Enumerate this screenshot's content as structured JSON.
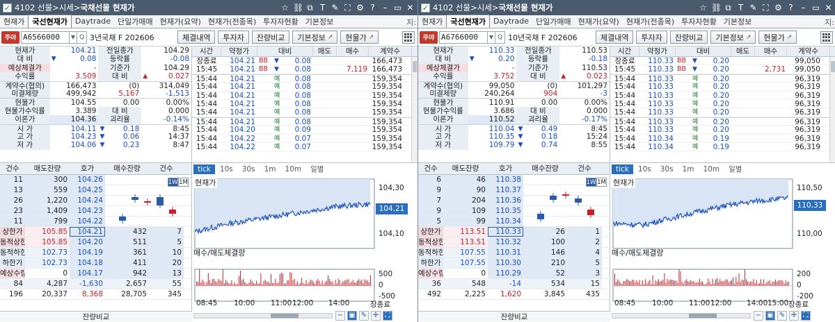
{
  "windows": [
    {
      "title_prefix": "4102 선물>시세>",
      "title_bold": "국채선물 현재가",
      "tabs": [
        "현재가",
        "국선현재가",
        "Daytrade",
        "단일가매매",
        "현재가(요약)",
        "현재가(전종목)",
        "투자자현황",
        "기본정보"
      ],
      "tab_more": "지:",
      "active_tab": 1,
      "code_badge": "주야",
      "code": "A6566000",
      "code_name": "3년국채 F 202606",
      "buttons": [
        "체결내역",
        "투자자",
        "잔량비교",
        "기본정보",
        "현물가"
      ],
      "quote": {
        "rows": [
          {
            "l1": "현재가",
            "v1": "104.21",
            "l2": "전일종가",
            "v2": "104.29"
          },
          {
            "l1": "대 비",
            "v1": "0.08",
            "l2": "등락률",
            "v2": "-0.08"
          },
          {
            "l1": "예상체결가",
            "v1": "-",
            "l2": "기준가",
            "v2": "104.29"
          },
          {
            "l1": "수익률",
            "v1": "3.509",
            "l2": "대 비",
            "v2": "0.027"
          },
          {
            "l1": "계약수(협의)",
            "v1": "166,473",
            "m": "(0)",
            "v2": "314,049"
          },
          {
            "l1": "미결제량",
            "v1": "499,942",
            "m": "5,167",
            "v2": "-1,513"
          },
          {
            "l1": "현물가",
            "v1": "104.55",
            "m": "0.00",
            "v2": "0.00%"
          },
          {
            "l1": "현물가수익률",
            "v1": "3.389",
            "l2": "대 비",
            "v2": "0.000"
          },
          {
            "l1": "이론가",
            "v1": "104.36",
            "l2": "괴리율",
            "v2": "-0.14%"
          },
          {
            "l1": "시 가",
            "v1": "104.11",
            "m": "0.18",
            "v2": "8:45"
          },
          {
            "l1": "고 가",
            "v1": "104.23",
            "m": "0.06",
            "v2": "14:37"
          },
          {
            "l1": "저 가",
            "v1": "104.06",
            "m": "0.23",
            "v2": "8:47"
          }
        ]
      },
      "trades": {
        "headers": [
          "시간",
          "약정가",
          "대비",
          "매도",
          "매수",
          "계약수"
        ],
        "rows": [
          {
            "t": "장종료",
            "p": "104.21",
            "bb": "BB",
            "c": "0.08",
            "ask": "",
            "bid": "",
            "v": "166,473"
          },
          {
            "t": "15:45",
            "p": "104.21",
            "bb": "BB",
            "c": "0.08",
            "ask": "",
            "bid": "7,119",
            "v": "166,473"
          },
          {
            "t": "15:44",
            "p": "104.21",
            "bb": "",
            "c": "0.08",
            "ask": "",
            "bid": "",
            "v": "159,354"
          },
          {
            "t": "15:44",
            "p": "104.21",
            "bb": "",
            "c": "0.08",
            "ask": "",
            "bid": "",
            "v": "159,354"
          },
          {
            "t": "15:44",
            "p": "104.21",
            "bb": "",
            "c": "0.08",
            "ask": "",
            "bid": "",
            "v": "159,354"
          },
          {
            "t": "15:44",
            "p": "104.21",
            "bb": "",
            "c": "0.08",
            "ask": "",
            "bid": "",
            "v": "159,354"
          },
          {
            "t": "15:44",
            "p": "104.21",
            "bb": "",
            "c": "0.08",
            "ask": "",
            "bid": "",
            "v": "159,354"
          },
          {
            "t": "15:44",
            "p": "104.21",
            "bb": "",
            "c": "0.08",
            "ask": "",
            "bid": "",
            "v": "159,354"
          },
          {
            "t": "15:44",
            "p": "104.20",
            "bb": "",
            "c": "0.09",
            "ask": "",
            "bid": "",
            "v": "159,354"
          },
          {
            "t": "15:44",
            "p": "104.22",
            "bb": "",
            "c": "0.07",
            "ask": "",
            "bid": "",
            "v": "159,354"
          },
          {
            "t": "15:44",
            "p": "104.22",
            "bb": "",
            "c": "0.07",
            "ask": "",
            "bid": "",
            "v": "159,354"
          }
        ]
      },
      "book": {
        "headers": [
          "건수",
          "매도잔량",
          "호가",
          "매수잔량",
          "건수"
        ],
        "asks": [
          {
            "cnt": "11",
            "qty": "300",
            "price": "104.26"
          },
          {
            "cnt": "13",
            "qty": "559",
            "price": "104.25"
          },
          {
            "cnt": "26",
            "qty": "1,220",
            "price": "104.24"
          },
          {
            "cnt": "23",
            "qty": "1,409",
            "price": "104.23"
          },
          {
            "cnt": "11",
            "qty": "799",
            "price": "104.22"
          }
        ],
        "bids": [
          {
            "lab": "상한가",
            "lv": "105.85",
            "price": "104.21",
            "qty": "432",
            "cnt": "7"
          },
          {
            "lab": "동적상한",
            "lv": "105.85",
            "price": "104.20",
            "qty": "511",
            "cnt": "5"
          },
          {
            "lab": "동적하한",
            "lv": "102.73",
            "price": "104.19",
            "qty": "361",
            "cnt": "10"
          },
          {
            "lab": "하한가",
            "lv": "102.73",
            "price": "104.18",
            "qty": "411",
            "cnt": "20"
          },
          {
            "lab": "예상수량",
            "lv": "0",
            "price": "104.17",
            "qty": "942",
            "cnt": "13"
          }
        ],
        "total1": [
          "84",
          "4,287",
          "-1,630",
          "2,657",
          "55"
        ],
        "total2": [
          "196",
          "20,337",
          "8,368",
          "28,705",
          "345"
        ],
        "footer": "잔량비교",
        "toggle": [
          "1W",
          "1M"
        ]
      },
      "chart": {
        "tabs": [
          "tick",
          "10s",
          "30s",
          "1m",
          "10m",
          "일별"
        ],
        "title": "현재가",
        "vol_title": "매수/매도체결량",
        "ytick_top": "104,30",
        "ytick_bot": "104,10",
        "price_tag": "104.21",
        "vol_ticks": [
          "500",
          "0",
          "-500"
        ],
        "xticks": [
          "08:45",
          "10:00",
          "11:00",
          "12:00",
          "14:00",
          "장종료"
        ]
      },
      "chart_data": {
        "type": "line",
        "title": "현재가",
        "ylim": [
          104.05,
          104.3
        ],
        "x": [
          "08:45",
          "10:00",
          "11:00",
          "12:00",
          "14:00",
          "15:45"
        ],
        "values": [
          104.11,
          104.14,
          104.16,
          104.18,
          104.2,
          104.21
        ],
        "vol_ylim": [
          -500,
          500
        ]
      }
    },
    {
      "title_prefix": "4102 선물>시세>",
      "title_bold": "국채선물 현재가",
      "tabs": [
        "현재가",
        "국선현재가",
        "Daytrade",
        "단일가매매",
        "현재가(요약)",
        "현재가(전종목)",
        "투자자현황",
        "기본정보"
      ],
      "tab_more": "지:",
      "active_tab": 1,
      "code_badge": "주야",
      "code": "A6766000",
      "code_name": "10년국채 F 202606",
      "buttons": [
        "체결내역",
        "투자자",
        "잔량비교",
        "기본정보",
        "현물가"
      ],
      "quote": {
        "rows": [
          {
            "l1": "현재가",
            "v1": "110.33",
            "l2": "전일종가",
            "v2": "110.53"
          },
          {
            "l1": "대 비",
            "v1": "0.20",
            "l2": "등락률",
            "v2": "-0.18"
          },
          {
            "l1": "예상체결가",
            "v1": "-",
            "l2": "기준가",
            "v2": "110.53"
          },
          {
            "l1": "수익률",
            "v1": "3.752",
            "l2": "대 비",
            "v2": "0.023"
          },
          {
            "l1": "계약수(협의)",
            "v1": "99,050",
            "m": "(0)",
            "v2": "101,297"
          },
          {
            "l1": "미결제량",
            "v1": "240,264",
            "m": "904",
            "v2": "-3"
          },
          {
            "l1": "현물가",
            "v1": "110.91",
            "m": "0.00",
            "v2": "0.00%"
          },
          {
            "l1": "현물가수익률",
            "v1": "3.686",
            "l2": "대 비",
            "v2": "0.000"
          },
          {
            "l1": "이론가",
            "v1": "110.52",
            "l2": "괴리율",
            "v2": "-0.17%"
          },
          {
            "l1": "시 가",
            "v1": "110.04",
            "m": "0.49",
            "v2": "8:45"
          },
          {
            "l1": "고 가",
            "v1": "110.35",
            "m": "0.18",
            "v2": "15:24"
          },
          {
            "l1": "저 가",
            "v1": "109.79",
            "m": "0.74",
            "v2": "8:55"
          }
        ]
      },
      "trades": {
        "headers": [
          "시간",
          "약정가",
          "대비",
          "매도",
          "매수",
          "계약수"
        ],
        "rows": [
          {
            "t": "장종료",
            "p": "110.33",
            "bb": "BB",
            "c": "0.20",
            "ask": "",
            "bid": "",
            "v": "99,050"
          },
          {
            "t": "15:45",
            "p": "110.33",
            "bb": "BB",
            "c": "0.20",
            "ask": "",
            "bid": "2,731",
            "v": "99,050"
          },
          {
            "t": "15:44",
            "p": "110.33",
            "bb": "",
            "c": "0.20",
            "ask": "",
            "bid": "",
            "v": "96,319"
          },
          {
            "t": "15:44",
            "p": "110.33",
            "bb": "",
            "c": "0.20",
            "ask": "",
            "bid": "",
            "v": "96,319"
          },
          {
            "t": "15:44",
            "p": "110.33",
            "bb": "",
            "c": "0.20",
            "ask": "",
            "bid": "",
            "v": "96,319"
          },
          {
            "t": "15:44",
            "p": "110.33",
            "bb": "",
            "c": "0.20",
            "ask": "",
            "bid": "",
            "v": "96,319"
          },
          {
            "t": "15:44",
            "p": "110.33",
            "bb": "",
            "c": "0.20",
            "ask": "",
            "bid": "",
            "v": "96,319"
          },
          {
            "t": "15:44",
            "p": "110.33",
            "bb": "",
            "c": "0.20",
            "ask": "",
            "bid": "",
            "v": "96,319"
          },
          {
            "t": "15:44",
            "p": "110.33",
            "bb": "",
            "c": "0.20",
            "ask": "",
            "bid": "",
            "v": "96,319"
          },
          {
            "t": "15:44",
            "p": "110.34",
            "bb": "",
            "c": "0.19",
            "ask": "",
            "bid": "",
            "v": "96,319"
          },
          {
            "t": "15:44",
            "p": "110.34",
            "bb": "",
            "c": "0.19",
            "ask": "",
            "bid": "",
            "v": "96,319"
          }
        ]
      },
      "book": {
        "headers": [
          "건수",
          "매도잔량",
          "호가",
          "매수잔량",
          "건수"
        ],
        "asks": [
          {
            "cnt": "6",
            "qty": "46",
            "price": "110.38"
          },
          {
            "cnt": "9",
            "qty": "90",
            "price": "110.37"
          },
          {
            "cnt": "7",
            "qty": "204",
            "price": "110.36"
          },
          {
            "cnt": "9",
            "qty": "109",
            "price": "110.35"
          },
          {
            "cnt": "5",
            "qty": "99",
            "price": "110.34"
          }
        ],
        "bids": [
          {
            "lab": "상한가",
            "lv": "113.51",
            "price": "110.33",
            "qty": "26",
            "cnt": "1"
          },
          {
            "lab": "동적상한",
            "lv": "113.51",
            "price": "110.32",
            "qty": "100",
            "cnt": "2"
          },
          {
            "lab": "동적하한",
            "lv": "107.55",
            "price": "110.31",
            "qty": "146",
            "cnt": "4"
          },
          {
            "lab": "하한가",
            "lv": "107.55",
            "price": "110.30",
            "qty": "210",
            "cnt": "5"
          },
          {
            "lab": "예상수량",
            "lv": "0",
            "price": "110.29",
            "qty": "52",
            "cnt": "3"
          }
        ],
        "total1": [
          "36",
          "548",
          "-14",
          "534",
          "15"
        ],
        "total2": [
          "492",
          "2,225",
          "1,620",
          "3,845",
          "435"
        ],
        "footer": "잔량비교",
        "toggle": [
          "1W",
          "1M"
        ]
      },
      "chart": {
        "tabs": [
          "tick",
          "10s",
          "30s",
          "1m",
          "10m",
          "일별"
        ],
        "title": "현재가",
        "vol_title": "매수/매도체결량",
        "ytick_top": "110,50",
        "ytick_bot": "110,00",
        "price_tag": "110,33",
        "vol_ticks": [
          "200",
          "0",
          "-200"
        ],
        "xticks": [
          "08:45",
          "10:00",
          "11:00",
          "12:00",
          "14:00",
          "15:00",
          "장종료"
        ]
      },
      "chart_data": {
        "type": "line",
        "title": "현재가",
        "ylim": [
          109.75,
          110.55
        ],
        "x": [
          "08:45",
          "10:00",
          "11:00",
          "12:00",
          "14:00",
          "15:00",
          "15:45"
        ],
        "values": [
          110.04,
          110.02,
          110.1,
          110.18,
          110.25,
          110.3,
          110.33
        ],
        "vol_ylim": [
          -200,
          200
        ]
      }
    }
  ]
}
